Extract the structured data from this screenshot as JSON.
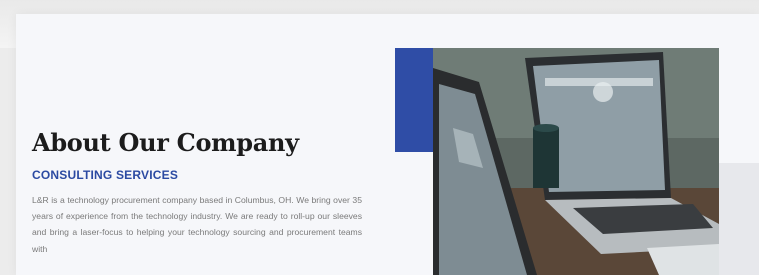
{
  "about": {
    "heading": "About Our Company",
    "subheading": "CONSULTING SERVICES",
    "paragraph": "L&R is a technology procurement company based in Columbus, OH. We bring over 35 years of experience from the technology industry. We are ready to roll-up our sleeves and bring a laser-focus to helping your technology sourcing and procurement teams with"
  },
  "colors": {
    "accent": "#2f4da6",
    "heading": "#1c1c1c",
    "subheading": "#2b4aa2"
  },
  "image": {
    "subject": "two laptops on a desk"
  }
}
